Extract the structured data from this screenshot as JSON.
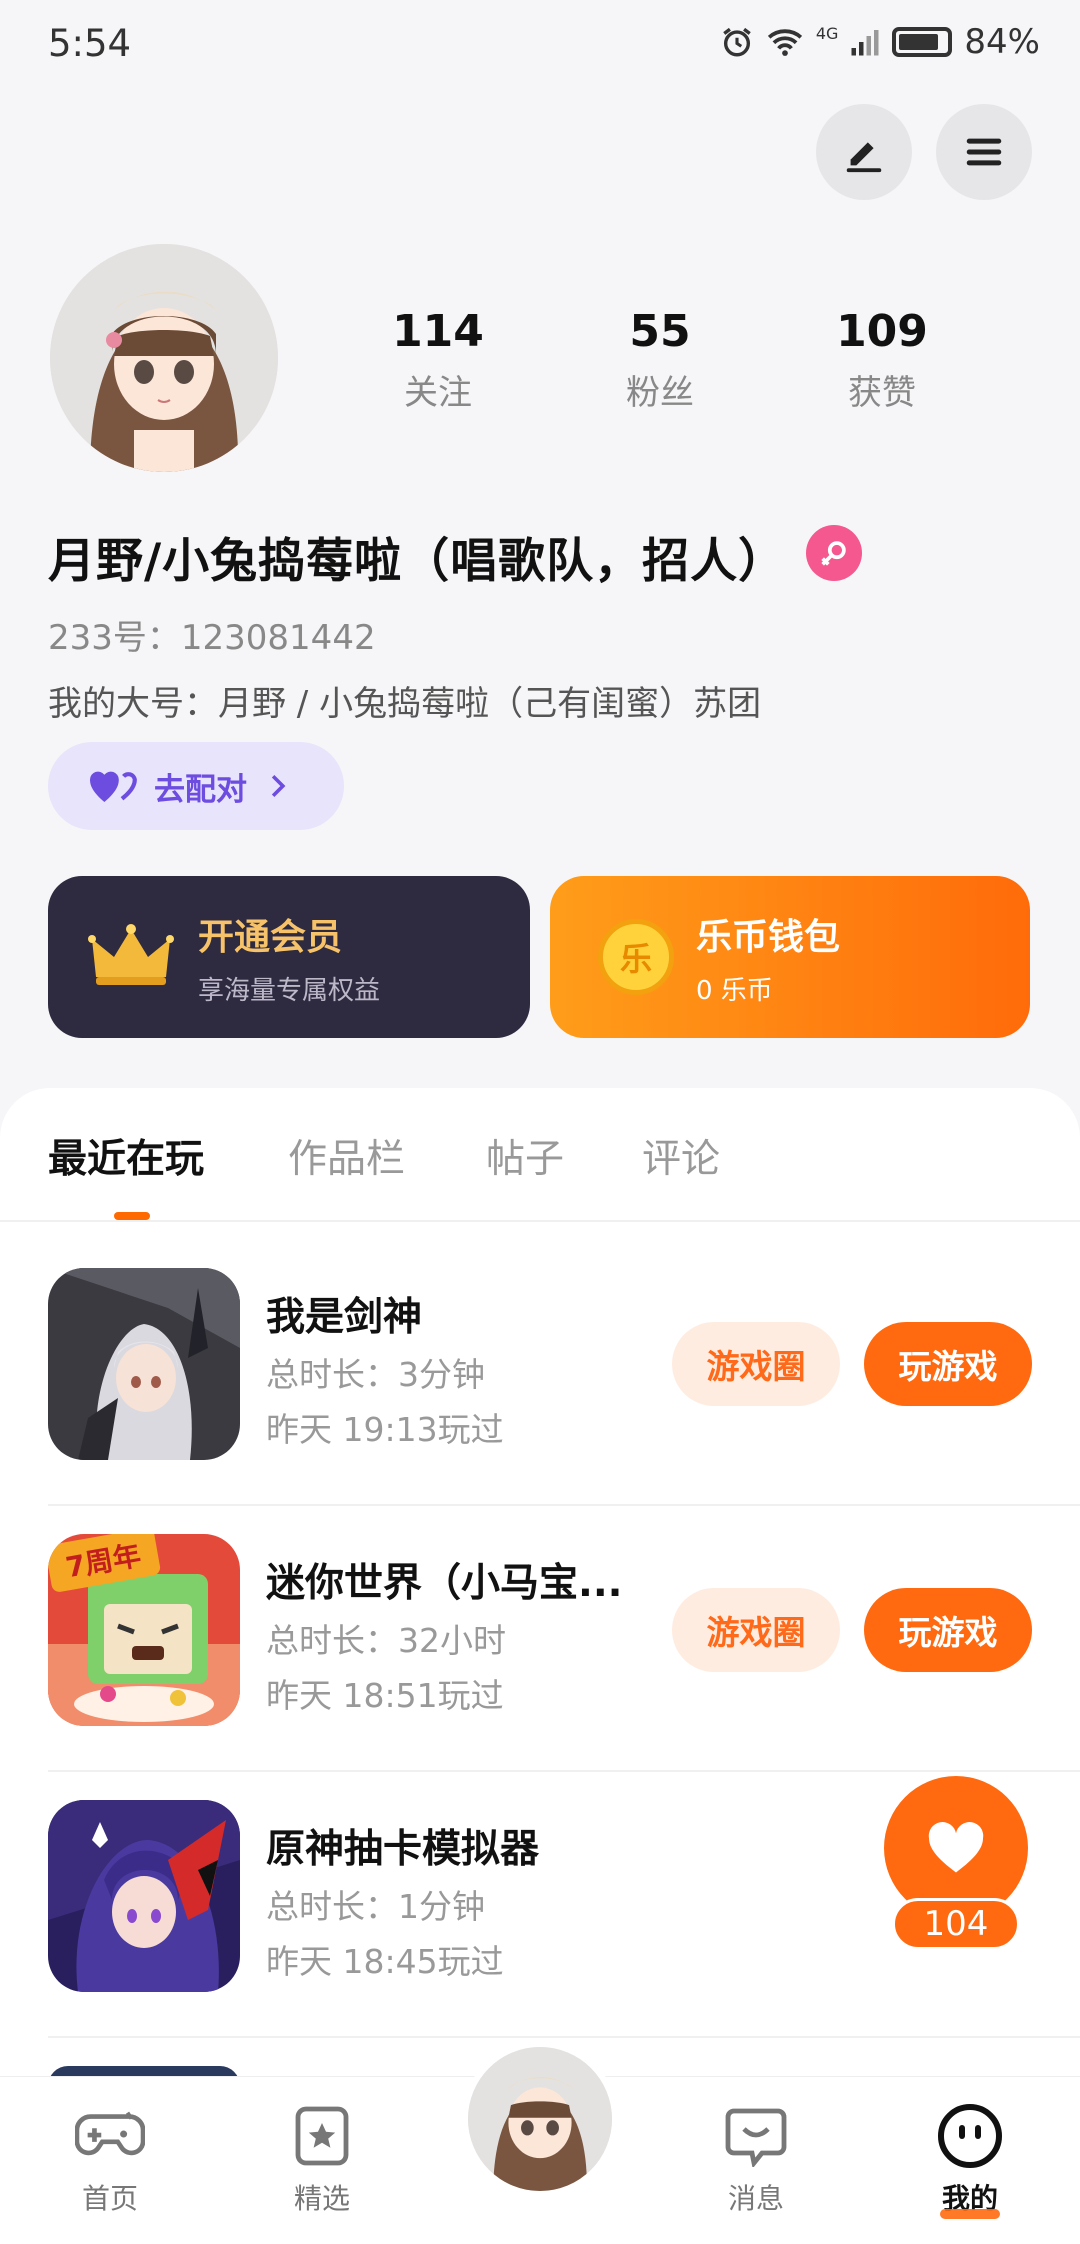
{
  "status_bar": {
    "time": "5:54",
    "network": "4G",
    "battery": "84%",
    "battery_level": 0.84
  },
  "profile": {
    "stats": [
      {
        "value": "114",
        "label": "关注"
      },
      {
        "value": "55",
        "label": "粉丝"
      },
      {
        "value": "109",
        "label": "获赞"
      }
    ],
    "nickname": "月野/小兔捣莓啦（唱歌队，招人）",
    "uid": "233号：123081442",
    "bio": "我的大号：月野 / 小兔捣莓啦（己有闺蜜）苏团",
    "pair_button": "去配对"
  },
  "cards": {
    "vip": {
      "title": "开通会员",
      "subtitle": "享海量专属权益"
    },
    "wallet": {
      "title": "乐币钱包",
      "subtitle": "0 乐币",
      "coin_glyph": "乐"
    }
  },
  "tabs": [
    "最近在玩",
    "作品栏",
    "帖子",
    "评论"
  ],
  "games": [
    {
      "name": "我是剑神",
      "duration": "总时长：3分钟",
      "last_played": "昨天 19:13玩过",
      "circle_label": "游戏圈",
      "play_label": "玩游戏"
    },
    {
      "name": "迷你世界（小马宝...",
      "duration": "总时长：32小时",
      "last_played": "昨天 18:51玩过",
      "circle_label": "游戏圈",
      "play_label": "玩游戏",
      "badge": "7周年"
    },
    {
      "name": "原神抽卡模拟器",
      "duration": "总时长：1分钟",
      "last_played": "昨天 18:45玩过"
    }
  ],
  "floating_like": {
    "count": "104"
  },
  "bottom_nav": [
    {
      "label": "首页"
    },
    {
      "label": "精选"
    },
    {
      "label": "消息"
    },
    {
      "label": "我的"
    }
  ],
  "colors": {
    "accent": "#ff6a10",
    "pair": "#6c4de0",
    "vip_bg": "#2e2a40",
    "female": "#f5588e"
  }
}
